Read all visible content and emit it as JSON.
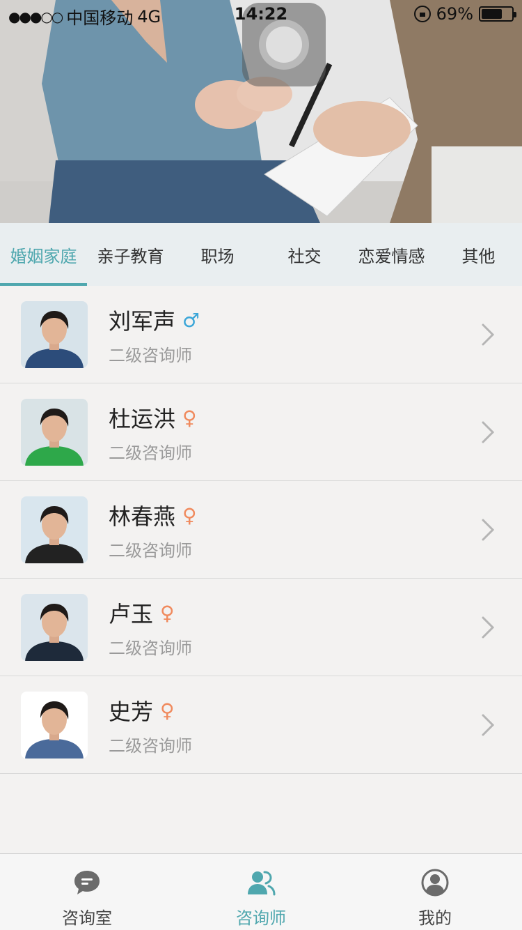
{
  "status_bar": {
    "signal": "●●●○○",
    "carrier": "中国移动",
    "network": "4G",
    "time": "14:22",
    "battery": "69%",
    "battery_level": 0.69
  },
  "tabs": [
    {
      "label": "婚姻家庭",
      "active": true
    },
    {
      "label": "亲子教育",
      "active": false
    },
    {
      "label": "职场",
      "active": false
    },
    {
      "label": "社交",
      "active": false
    },
    {
      "label": "恋爱情感",
      "active": false
    },
    {
      "label": "其他",
      "active": false
    }
  ],
  "counselors": [
    {
      "name": "刘军声",
      "gender": "male",
      "gender_symbol": "♂",
      "title": "二级咨询师",
      "shirt": "#2c4c7a",
      "bg": "#d7e3ea"
    },
    {
      "name": "杜运洪",
      "gender": "female",
      "gender_symbol": "♀",
      "title": "二级咨询师",
      "shirt": "#2ea84a",
      "bg": "#d9e3e6"
    },
    {
      "name": "林春燕",
      "gender": "female",
      "gender_symbol": "♀",
      "title": "二级咨询师",
      "shirt": "#222222",
      "bg": "#d9e6ee"
    },
    {
      "name": "卢玉",
      "gender": "female",
      "gender_symbol": "♀",
      "title": "二级咨询师",
      "shirt": "#1e2a3a",
      "bg": "#dbe5ec"
    },
    {
      "name": "史芳",
      "gender": "female",
      "gender_symbol": "♀",
      "title": "二级咨询师",
      "shirt": "#4a6a9a",
      "bg": "#ffffff"
    }
  ],
  "tabbar": [
    {
      "label": "咨询室",
      "icon": "chat-bubble-icon",
      "active": false
    },
    {
      "label": "咨询师",
      "icon": "counselors-icon",
      "active": true
    },
    {
      "label": "我的",
      "icon": "profile-icon",
      "active": false
    }
  ],
  "colors": {
    "accent": "#4fa7ae",
    "male": "#3ba6d8",
    "female": "#f08a5d"
  }
}
